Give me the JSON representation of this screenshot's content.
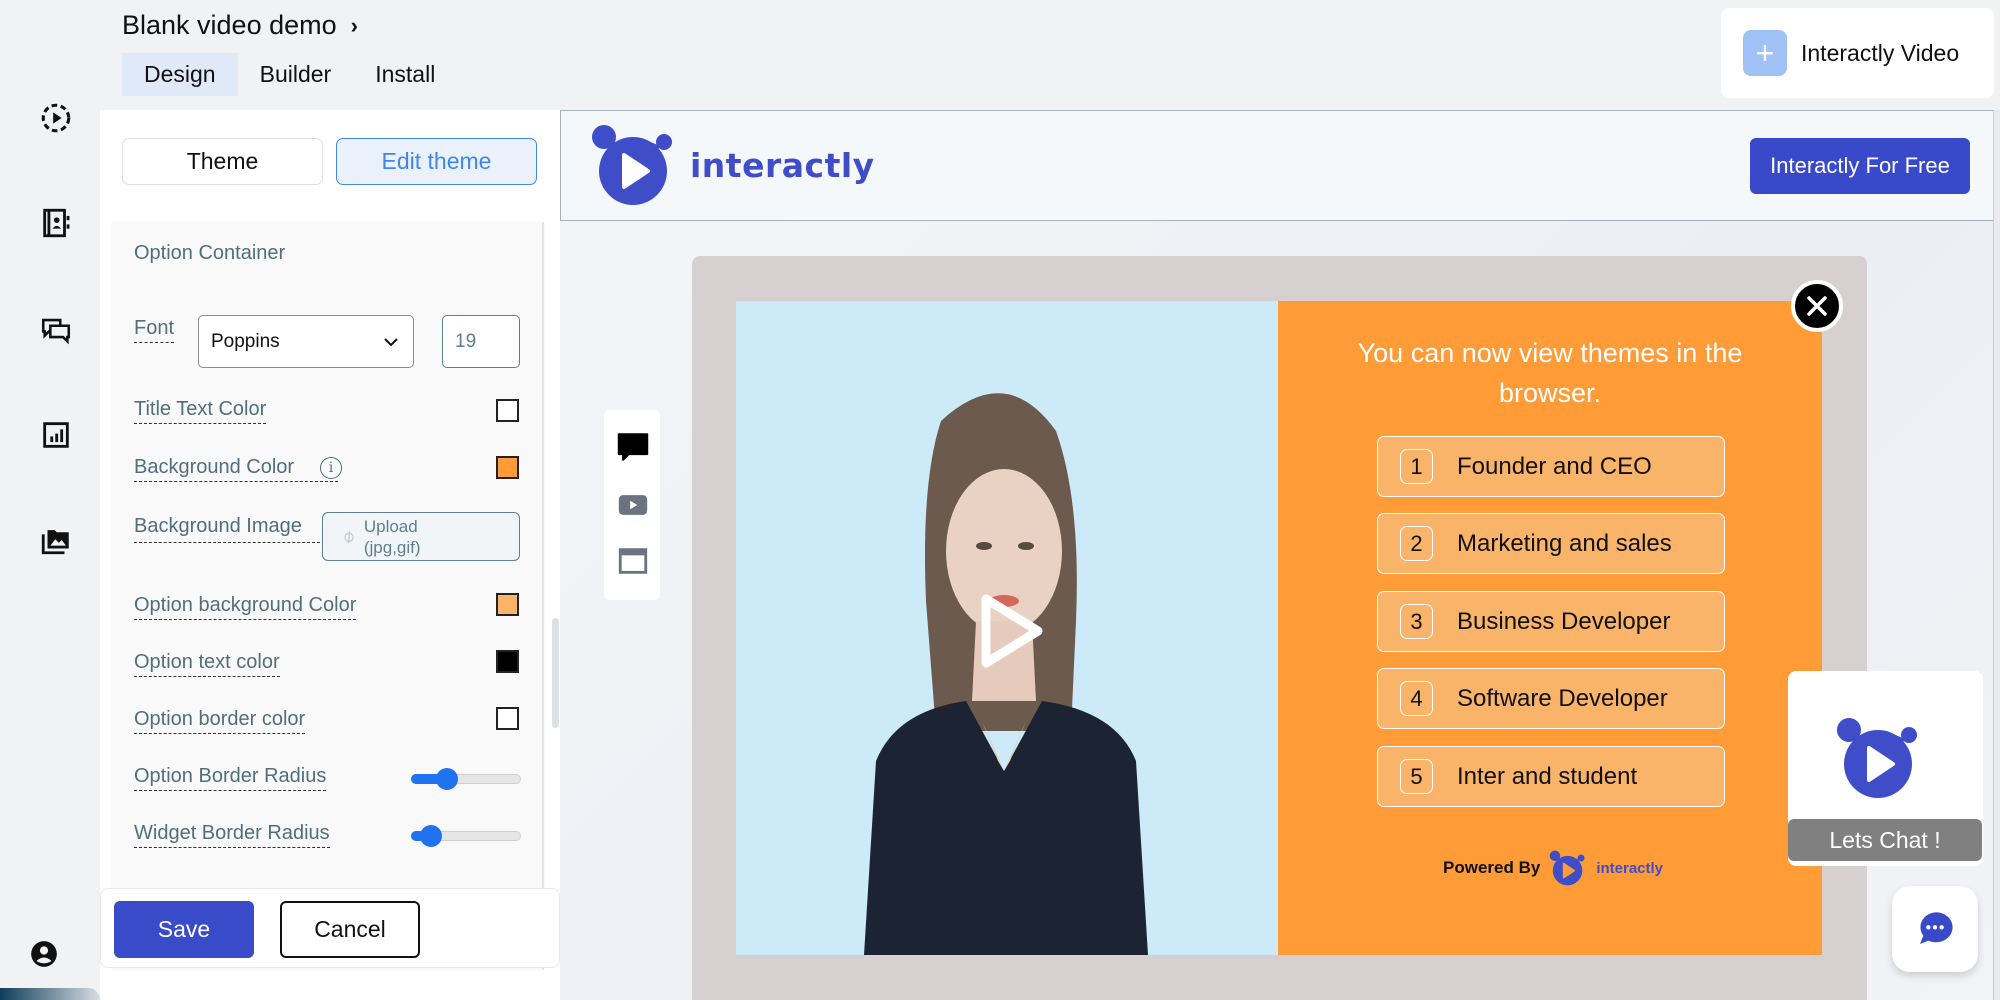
{
  "header": {
    "project_title": "Blank video demo",
    "tabs": [
      {
        "label": "Design",
        "active": true
      },
      {
        "label": "Builder",
        "active": false
      },
      {
        "label": "Install",
        "active": false
      }
    ]
  },
  "rail": {
    "icons": [
      "video-play-icon",
      "contacts-icon",
      "chat-bubbles-icon",
      "analytics-icon",
      "media-library-icon",
      "user-account-icon"
    ]
  },
  "panel": {
    "theme_label": "Theme",
    "edit_theme_label": "Edit theme",
    "section_title": "Option Container",
    "font_label": "Font",
    "font_value": "Poppins",
    "font_size_value": "19",
    "title_text_color_label": "Title Text Color",
    "title_text_color": "#ffffff",
    "background_color_label": "Background Color",
    "background_color": "#ff9c38",
    "background_image_label": "Background Image",
    "upload_label": "Upload (jpg,gif)",
    "option_bg_color_label": "Option background Color",
    "option_bg_color": "#f9b46a",
    "option_text_color_label": "Option text color",
    "option_text_color": "#000000",
    "option_border_color_label": "Option border color",
    "option_border_color": "#ffffff",
    "option_border_radius_label": "Option Border Radius",
    "option_border_radius_value": 0.33,
    "widget_border_radius_label": "Widget Border Radius",
    "widget_border_radius_value": 0.18,
    "save_label": "Save",
    "cancel_label": "Cancel"
  },
  "topbar": {
    "new_button_label": "Interactly Video"
  },
  "preview": {
    "brand_name": "interactly",
    "cta_label": "Interactly For Free",
    "question": "You can now view themes in the browser.",
    "options": [
      {
        "num": "1",
        "text": "Founder and CEO"
      },
      {
        "num": "2",
        "text": "Marketing and sales"
      },
      {
        "num": "3",
        "text": "Business Developer"
      },
      {
        "num": "4",
        "text": "Software Developer"
      },
      {
        "num": "5",
        "text": "Inter and student"
      }
    ],
    "powered_by": "Powered By",
    "powered_brand": "interactly",
    "chat_widget_label": "Lets Chat !"
  },
  "colors": {
    "accent": "#384bc9",
    "quiz_bg": "#ff9c38",
    "option_bg": "#f9b46a",
    "video_bg": "#cdeaf8"
  }
}
